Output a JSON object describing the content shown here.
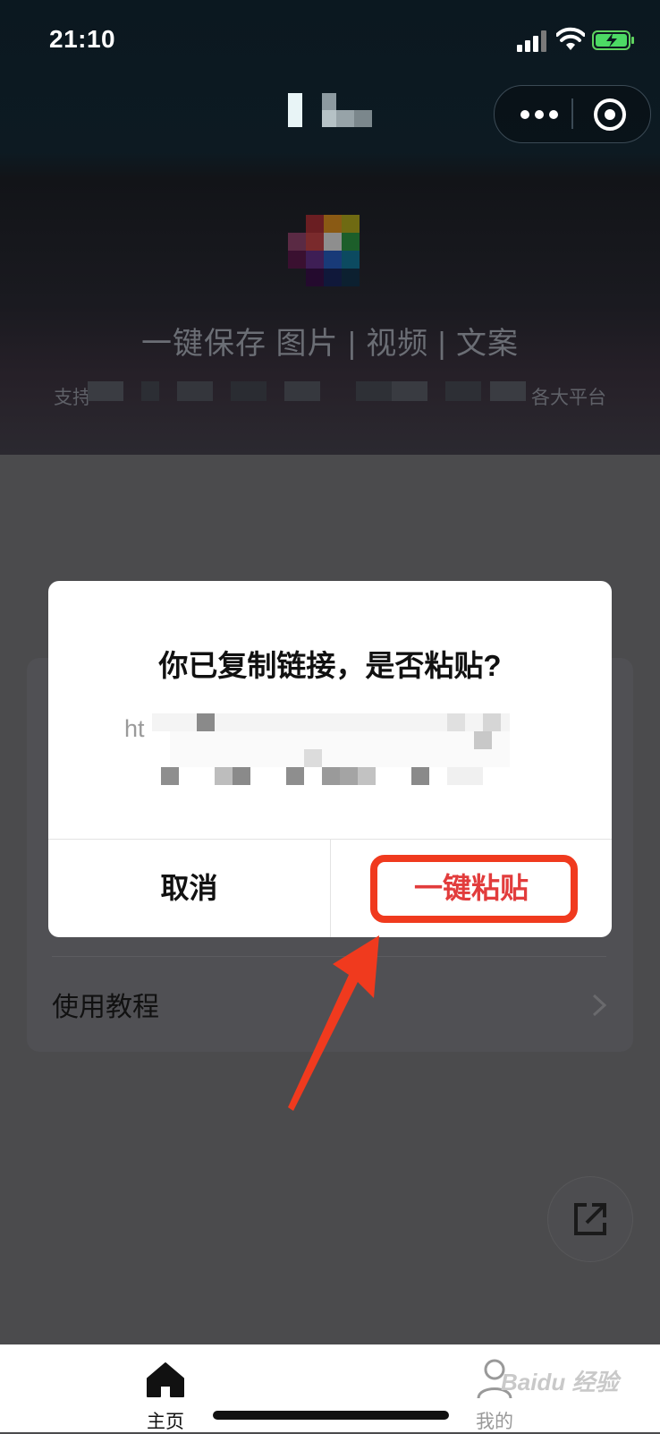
{
  "status_bar": {
    "time": "21:10"
  },
  "header": {
    "slogan": "一键保存 图片 | 视频 | 文案",
    "sub_left": "支持",
    "sub_right": "各大平台"
  },
  "list": {
    "tutorial_label": "使用教程"
  },
  "dialog": {
    "title": "你已复制链接，是否粘贴?",
    "link_prefix": "ht",
    "cancel_label": "取消",
    "paste_label": "一键粘贴"
  },
  "tabbar": {
    "home_label": "主页",
    "mine_label": "我的"
  },
  "watermark": "Baidu 经验",
  "colors": {
    "accent_red": "#e23c3c",
    "annotation_red": "#f03a1e",
    "overlay": "#4b4b4d"
  }
}
